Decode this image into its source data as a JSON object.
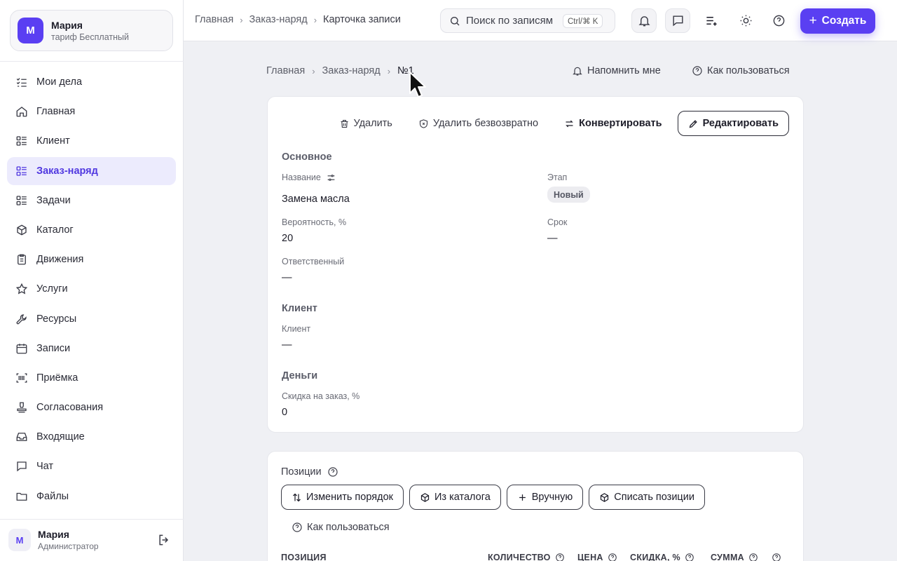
{
  "account": {
    "avatar_letter": "М",
    "name": "Мария",
    "plan": "тариф Бесплатный"
  },
  "sidebar": {
    "items": [
      {
        "label": "Мои дела",
        "icon": "checklist-icon",
        "active": false
      },
      {
        "label": "Главная",
        "icon": "home-icon",
        "active": false
      },
      {
        "label": "Клиент",
        "icon": "list-icon",
        "active": false
      },
      {
        "label": "Заказ-наряд",
        "icon": "list-icon",
        "active": true
      },
      {
        "label": "Задачи",
        "icon": "list-icon",
        "active": false
      },
      {
        "label": "Каталог",
        "icon": "box-icon",
        "active": false
      },
      {
        "label": "Движения",
        "icon": "clipboard-icon",
        "active": false
      },
      {
        "label": "Услуги",
        "icon": "star-icon",
        "active": false
      },
      {
        "label": "Ресурсы",
        "icon": "wrench-icon",
        "active": false
      },
      {
        "label": "Записи",
        "icon": "calendar-icon",
        "active": false
      },
      {
        "label": "Приёмка",
        "icon": "scan-icon",
        "active": false
      },
      {
        "label": "Согласования",
        "icon": "stamp-icon",
        "active": false
      },
      {
        "label": "Входящие",
        "icon": "inbox-icon",
        "active": false
      },
      {
        "label": "Чат",
        "icon": "chat-icon",
        "active": false
      },
      {
        "label": "Файлы",
        "icon": "folder-icon",
        "active": false
      }
    ]
  },
  "user": {
    "avatar_letter": "М",
    "name": "Мария",
    "role": "Администратор"
  },
  "topbar": {
    "breadcrumb": [
      "Главная",
      "Заказ-наряд",
      "Карточка записи"
    ],
    "search_placeholder": "Поиск по записям",
    "search_shortcut": "Ctrl/⌘ K",
    "create_label": "Создать"
  },
  "page": {
    "breadcrumb": [
      "Главная",
      "Заказ-наряд",
      "№1"
    ],
    "remind_label": "Напомнить мне",
    "howto_label": "Как пользоваться"
  },
  "record": {
    "actions": {
      "delete": "Удалить",
      "delete_forever": "Удалить безвозвратно",
      "convert": "Конвертировать",
      "edit": "Редактировать"
    },
    "sections": {
      "main": "Основное",
      "client": "Клиент",
      "money": "Деньги"
    },
    "fields": {
      "name_label": "Название",
      "name_value": "Замена масла",
      "stage_label": "Этап",
      "stage_value": "Новый",
      "probability_label": "Вероятность, %",
      "probability_value": "20",
      "deadline_label": "Срок",
      "deadline_value": "—",
      "responsible_label": "Ответственный",
      "responsible_value": "—",
      "client_label": "Клиент",
      "client_value": "—",
      "discount_label": "Скидка на заказ, %",
      "discount_value": "0"
    }
  },
  "positions": {
    "title": "Позиции",
    "buttons": [
      "Изменить порядок",
      "Из каталога",
      "Вручную",
      "Списать позиции"
    ],
    "howto_label": "Как пользоваться",
    "columns": [
      "ПОЗИЦИЯ",
      "КОЛИЧЕСТВО",
      "ЦЕНА",
      "СКИДКА, %",
      "СУММА"
    ]
  },
  "colors": {
    "accent": "#5a3ff2",
    "active_bg": "#ecebfd",
    "page_bg": "#eff0f4"
  }
}
